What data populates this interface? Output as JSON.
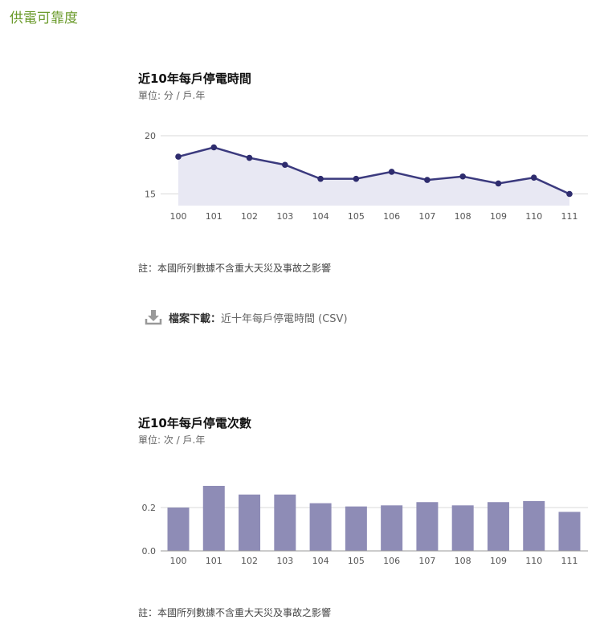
{
  "page_title": "供電可靠度",
  "charts": [
    {
      "title": "近10年每戶停電時間",
      "unit": "單位: 分 / 戶.年",
      "note": "註：本國所列數據不含重大天災及事故之影響",
      "download_label": "檔案下載：",
      "download_link": "近十年每戶停電時間 (CSV)"
    },
    {
      "title": "近10年每戶停電次數",
      "unit": "單位: 次 / 戶.年",
      "note": "註：本國所列數據不含重大天災及事故之影響"
    }
  ],
  "chart_data": [
    {
      "type": "area",
      "categories": [
        "100",
        "101",
        "102",
        "103",
        "104",
        "105",
        "106",
        "107",
        "108",
        "109",
        "110",
        "111"
      ],
      "values": [
        18.2,
        19.0,
        18.1,
        17.5,
        16.3,
        16.3,
        16.9,
        16.2,
        16.5,
        15.9,
        16.4,
        15.0
      ],
      "yticks": [
        15,
        20
      ],
      "ylim": [
        14,
        20
      ],
      "colors": {
        "line": "#3b3a7e",
        "fill": "#e8e8f3",
        "point": "#2e2c6e"
      }
    },
    {
      "type": "bar",
      "categories": [
        "100",
        "101",
        "102",
        "103",
        "104",
        "105",
        "106",
        "107",
        "108",
        "109",
        "110",
        "111"
      ],
      "values": [
        0.2,
        0.3,
        0.26,
        0.26,
        0.22,
        0.205,
        0.21,
        0.225,
        0.21,
        0.225,
        0.23,
        0.18
      ],
      "yticks": [
        "0.0",
        "0.2"
      ],
      "ylim": [
        0,
        0.3
      ],
      "colors": {
        "bar": "#8e8cb6"
      }
    }
  ]
}
